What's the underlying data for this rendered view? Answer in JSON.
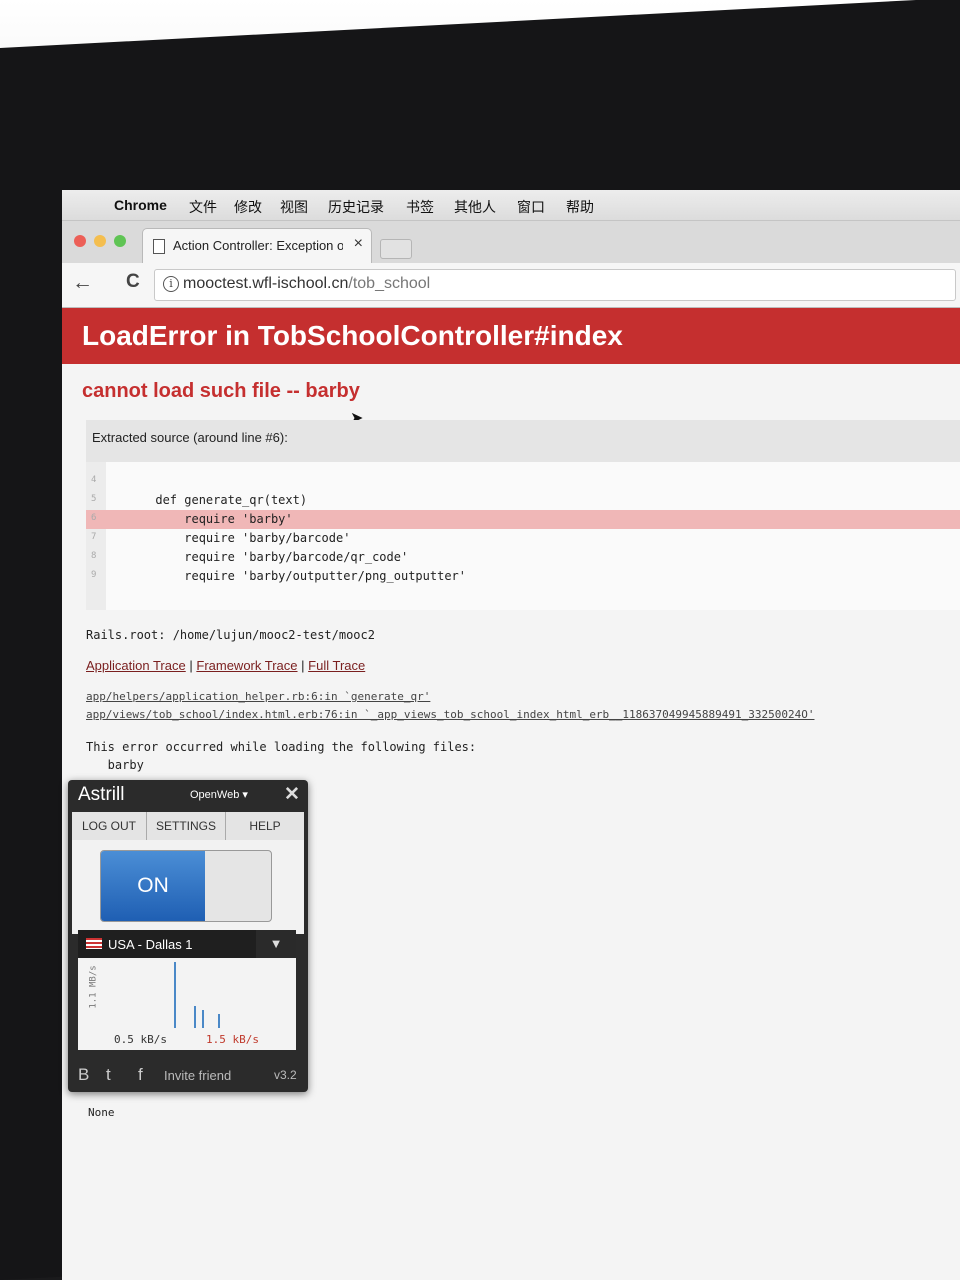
{
  "menubar": {
    "apple": "",
    "app": "Chrome",
    "items": [
      "文件",
      "修改",
      "视图",
      "历史记录",
      "书签",
      "其他人",
      "窗口",
      "帮助"
    ]
  },
  "tab": {
    "title": "Action Controller: Exception o",
    "close": "×"
  },
  "toolbar": {
    "back": "←",
    "reload": "C",
    "url_host": "mooctest.wfl-ischool.cn",
    "url_path": "/tob_school"
  },
  "error": {
    "title": "LoadError in TobSchoolController#index",
    "message": "cannot load such file -- barby",
    "source_heading": "Extracted source (around line #6):",
    "code_lines": [
      {
        "num": "4",
        "text": ""
      },
      {
        "num": "5",
        "text": "      def generate_qr(text)"
      },
      {
        "num": "6",
        "text": "          require 'barby'"
      },
      {
        "num": "7",
        "text": "          require 'barby/barcode'"
      },
      {
        "num": "8",
        "text": "          require 'barby/barcode/qr_code'"
      },
      {
        "num": "9",
        "text": "          require 'barby/outputter/png_outputter'"
      }
    ],
    "rails_root": "Rails.root: /home/lujun/mooc2-test/mooc2",
    "trace_links": [
      "Application Trace",
      "Framework Trace",
      "Full Trace"
    ],
    "trace_sep": "|",
    "trace_lines": [
      "app/helpers/application_helper.rb:6:in `generate_qr'",
      "app/views/tob_school/index.html.erb:76:in `_app_views_tob_school_index_html_erb__118637049945889491_33250024O'"
    ],
    "loading_msg": "This error occurred while loading the following files:",
    "loading_file": "   barby",
    "none": "None"
  },
  "astrill": {
    "title": "Astrill",
    "mode": "OpenWeb ▾",
    "close": "✕",
    "tabs": [
      "LOG OUT",
      "SETTINGS",
      "HELP"
    ],
    "switch_label": "ON",
    "server": "USA - Dallas 1",
    "y_label": "1.1 MB/s",
    "download": "0.5 kB/s",
    "upload": "1.5 kB/s",
    "invite": "Invite friend",
    "version": "v3.2"
  }
}
